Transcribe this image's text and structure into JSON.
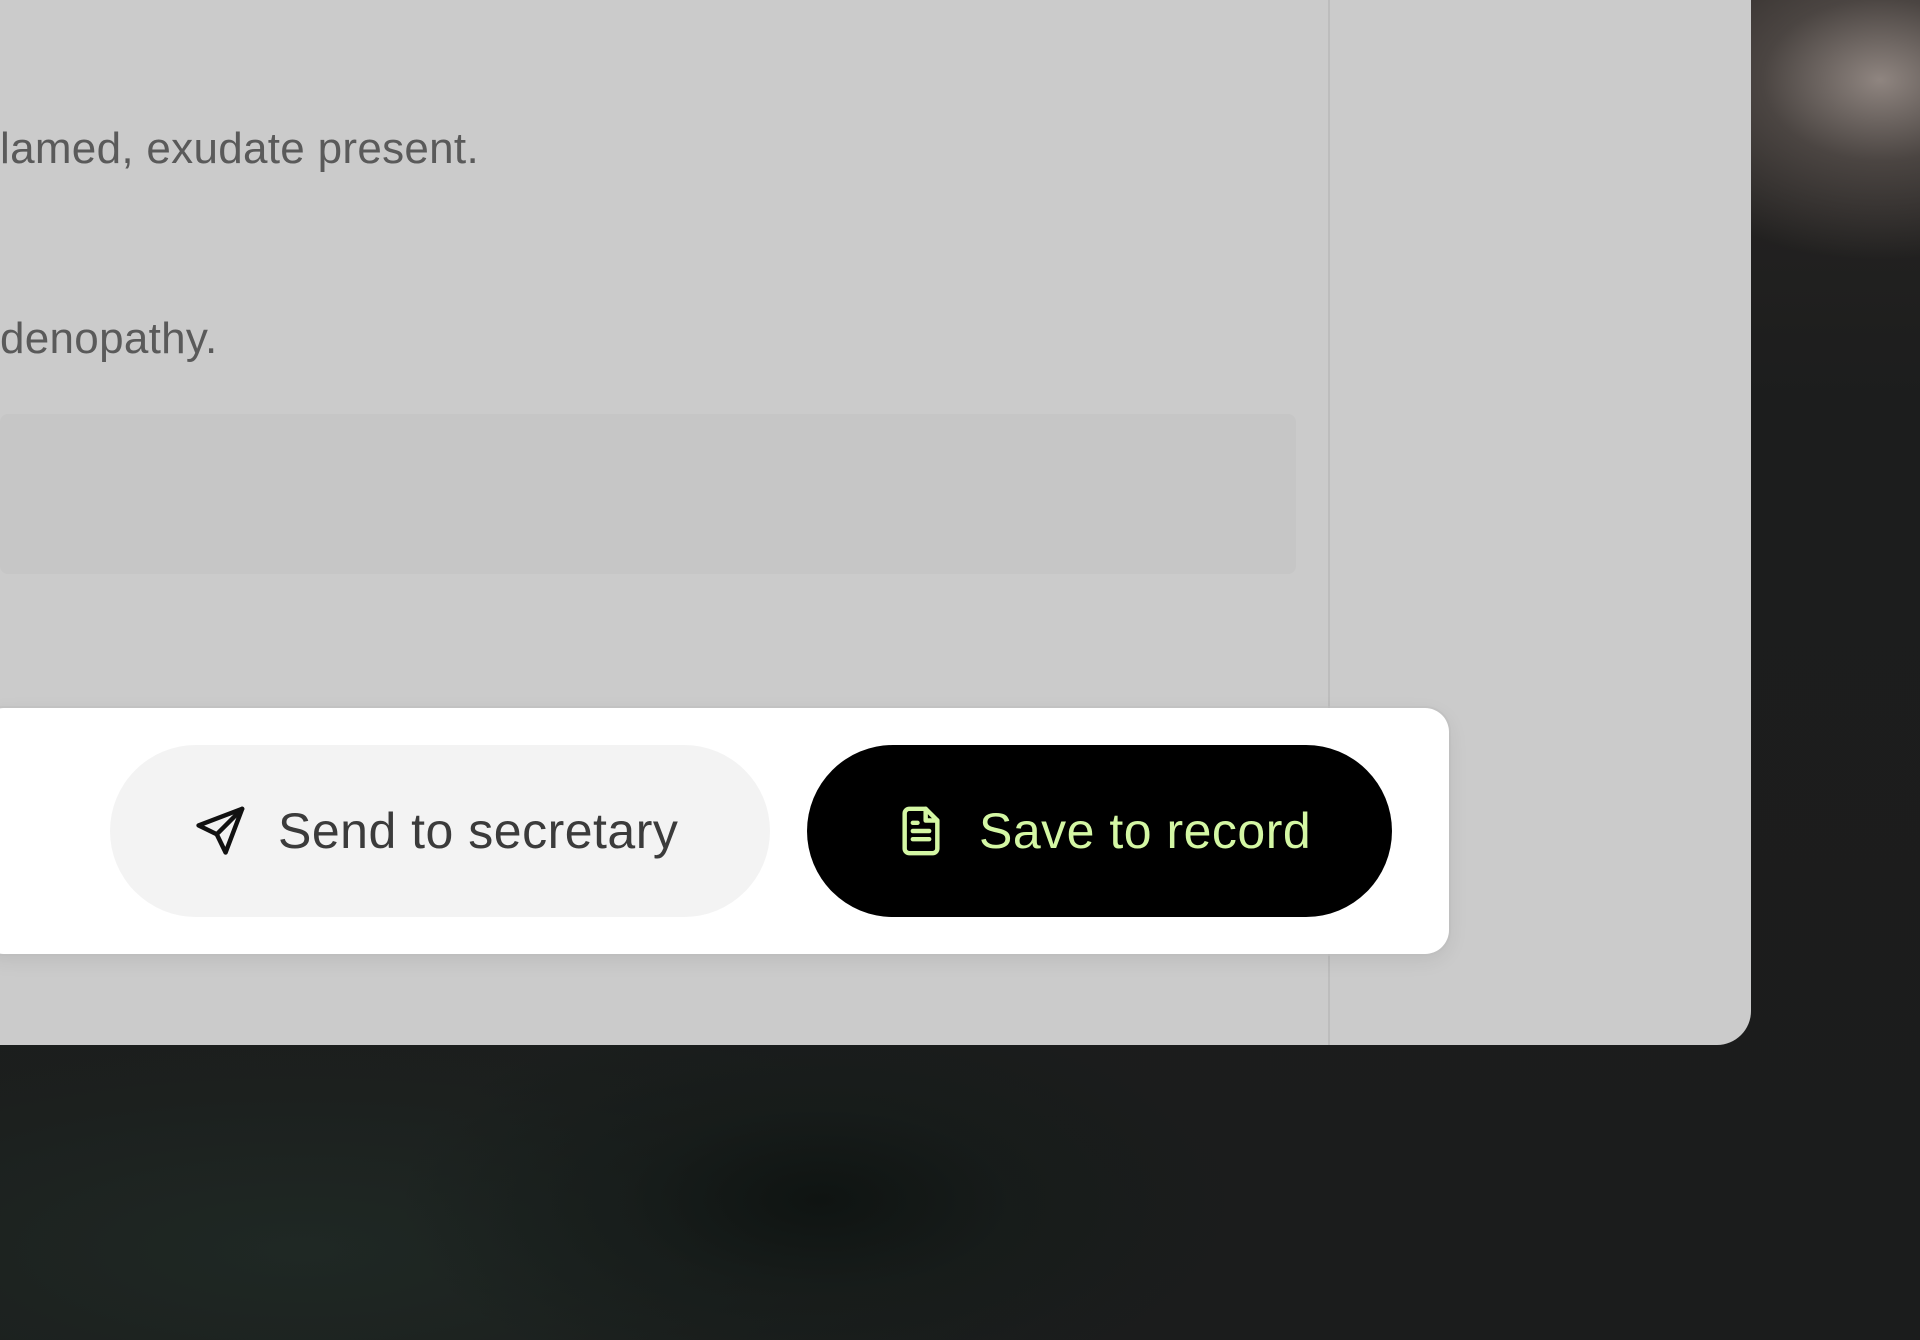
{
  "note": {
    "lines": [
      "lamed, exudate present.",
      "denopathy."
    ]
  },
  "actions": {
    "send_label": "Send to secretary",
    "send_icon": "send-icon",
    "save_label": "Save to record",
    "save_icon": "document-icon"
  },
  "colors": {
    "primary_button_bg": "#000000",
    "primary_button_text": "#d4f7a4",
    "secondary_button_bg": "#f3f3f3"
  }
}
